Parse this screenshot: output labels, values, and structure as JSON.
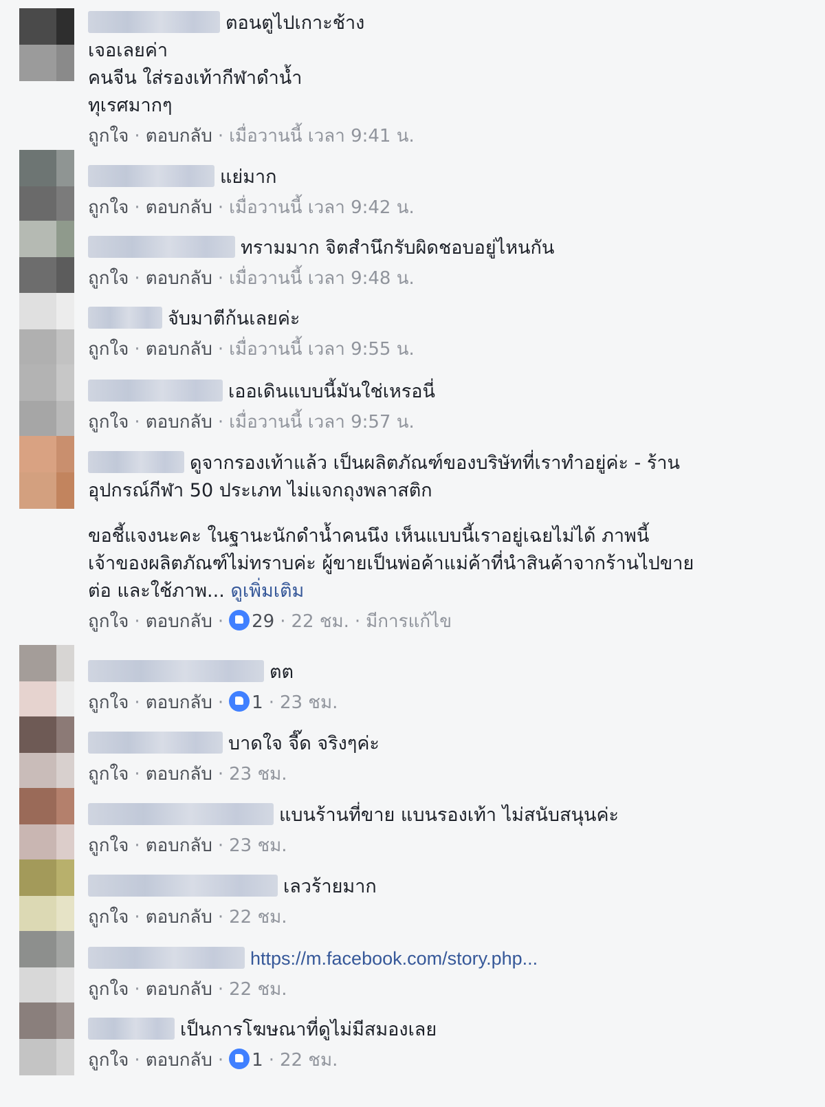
{
  "actions": {
    "like": "ถูกใจ",
    "reply": "ตอบกลับ",
    "separator": "·"
  },
  "comments": [
    {
      "lines": [
        "ตอนตูไปเกาะช้าง",
        "เจอเลยค่า",
        "คนจีน ใส่รองเท้ากีฬาดำน้ำ",
        "ทุเรศมากๆ"
      ],
      "time": "เมื่อวานนี้ เวลา 9:41 น."
    },
    {
      "lines": [
        "แย่มาก"
      ],
      "time": "เมื่อวานนี้ เวลา 9:42 น."
    },
    {
      "lines": [
        "ทรามมาก จิตสำนึกรับผิดชอบอยู่ไหนกัน"
      ],
      "time": "เมื่อวานนี้ เวลา 9:48 น."
    },
    {
      "lines": [
        "จับมาตีก้นเลยค่ะ"
      ],
      "time": "เมื่อวานนี้ เวลา 9:55 น."
    },
    {
      "lines": [
        "เออเดินแบบนี้มันใช่เหรอนี่"
      ],
      "time": "เมื่อวานนี้ เวลา 9:57 น."
    },
    {
      "lines": [
        "ดูจากรองเท้าแล้ว เป็นผลิตภัณฑ์ของบริษัทที่เราทำอยู่ค่ะ - ร้าน",
        "อุปกรณ์กีฬา 50 ประเภท ไม่แจกถุงพลาสติก"
      ],
      "lines2": [
        "ขอชี้แจงนะคะ ในฐานะนักดำน้ำคนนึง เห็นแบบนี้เราอยู่เฉยไม่ได้ ภาพนี้",
        "เจ้าของผลิตภัณฑ์ไม่ทราบค่ะ ผู้ขายเป็นพ่อค้าแม่ค้าที่นำสินค้าจากร้านไปขาย",
        "ต่อ และใช้ภาพ..."
      ],
      "see_more": "ดูเพิ่มเติม",
      "likes": "29",
      "time": "22 ชม.",
      "edited": "มีการแก้ไข"
    },
    {
      "lines": [
        "ตต"
      ],
      "likes": "1",
      "time": "23 ชม."
    },
    {
      "lines": [
        "บาดใจ จี๊ด จริงๆค่ะ"
      ],
      "time": "23 ชม."
    },
    {
      "lines": [
        "แบนร้านที่ขาย แบนรองเท้า ไม่สนับสนุนค่ะ"
      ],
      "time": "23 ชม."
    },
    {
      "lines": [
        "เลวร้ายมาก"
      ],
      "time": "22 ชม."
    },
    {
      "lines": [
        "https://m.facebook.com/story.php..."
      ],
      "time": "22 ชม."
    },
    {
      "lines": [
        "เป็นการโฆษณาที่ดูไม่มีสมองเลย"
      ],
      "likes": "1",
      "time": "22 ชม."
    }
  ]
}
